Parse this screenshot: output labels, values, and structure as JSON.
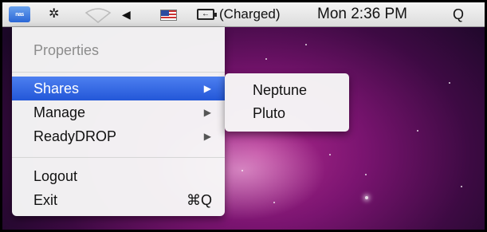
{
  "menubar": {
    "app_icon": "netgear-readynas-icon",
    "app_icon_text": "nas",
    "bluetooth_icon": "✲",
    "wifi_icon": "wifi-icon",
    "volume_icon": "◀",
    "flag_icon": "us-flag-icon",
    "battery_glyph": "←",
    "battery_status": "(Charged)",
    "clock": "Mon 2:36 PM",
    "spotlight_icon": "Q"
  },
  "menu": {
    "properties": "Properties",
    "shares": "Shares",
    "manage": "Manage",
    "readydrop": "ReadyDROP",
    "logout": "Logout",
    "exit": "Exit",
    "exit_shortcut": "⌘Q",
    "submenu_arrow": "▶"
  },
  "submenu": {
    "items": [
      "Neptune",
      "Pluto"
    ]
  },
  "colors": {
    "selection": "#2f63e0",
    "desktop": "#7a1470"
  }
}
